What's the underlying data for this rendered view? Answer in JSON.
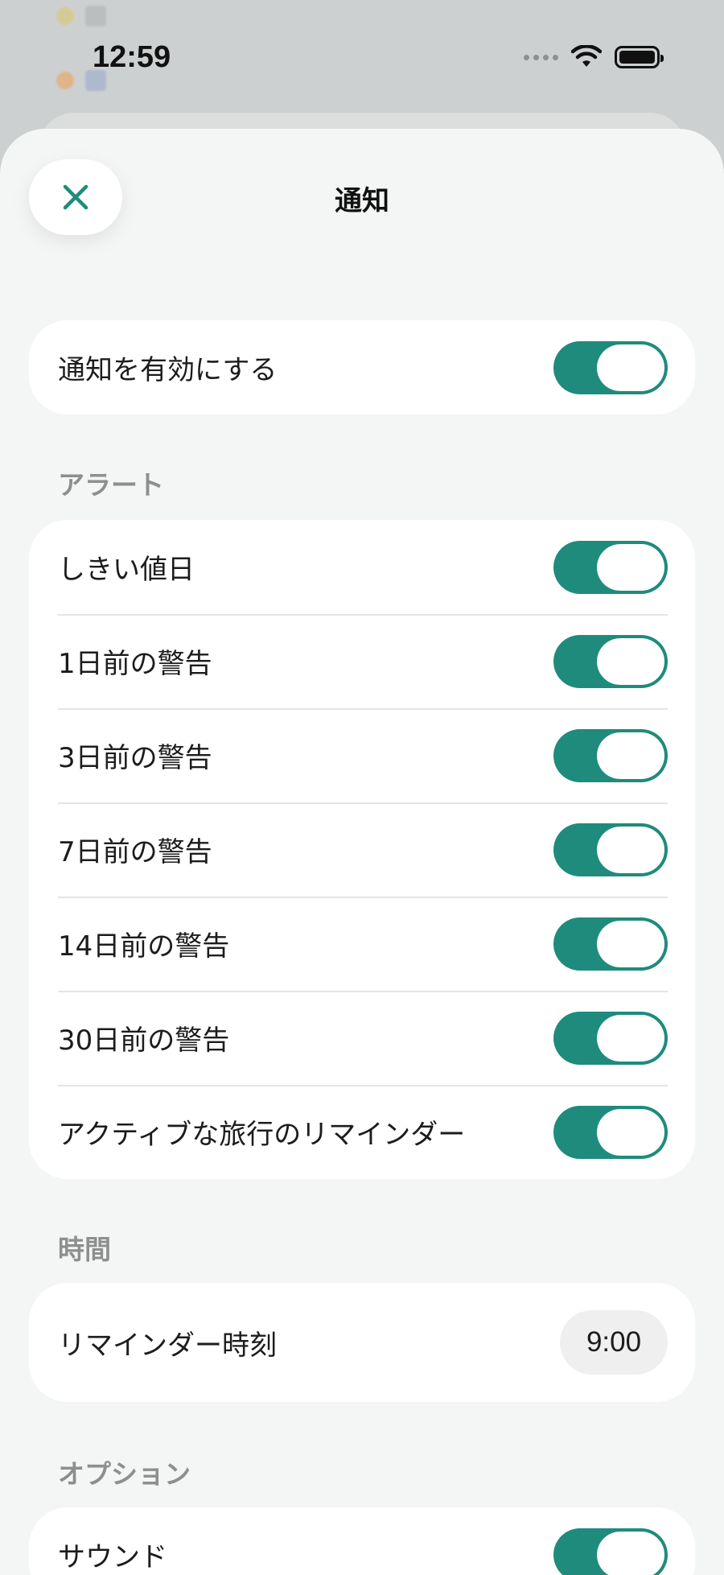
{
  "status_bar": {
    "time": "12:59"
  },
  "sheet": {
    "title": "通知"
  },
  "enable_card": {
    "label": "通知を有効にする",
    "on": true
  },
  "alerts": {
    "header": "アラート",
    "items": [
      {
        "label": "しきい値日",
        "on": true
      },
      {
        "label": "1日前の警告",
        "on": true
      },
      {
        "label": "3日前の警告",
        "on": true
      },
      {
        "label": "7日前の警告",
        "on": true
      },
      {
        "label": "14日前の警告",
        "on": true
      },
      {
        "label": "30日前の警告",
        "on": true
      },
      {
        "label": "アクティブな旅行のリマインダー",
        "on": true
      }
    ]
  },
  "time_section": {
    "header": "時間",
    "reminder_label": "リマインダー時刻",
    "reminder_value": "9:00"
  },
  "options": {
    "header": "オプション",
    "items": [
      {
        "label": "サウンド",
        "on": true
      }
    ]
  },
  "colors": {
    "accent": "#1f8b7c",
    "sheet_bg": "#f4f5f5",
    "card_bg": "#ffffff",
    "secondary_text": "#8e8e8e"
  },
  "icons": {
    "close": "close-icon",
    "wifi": "wifi-icon",
    "battery": "battery-icon",
    "signal": "signal-dots-icon"
  }
}
